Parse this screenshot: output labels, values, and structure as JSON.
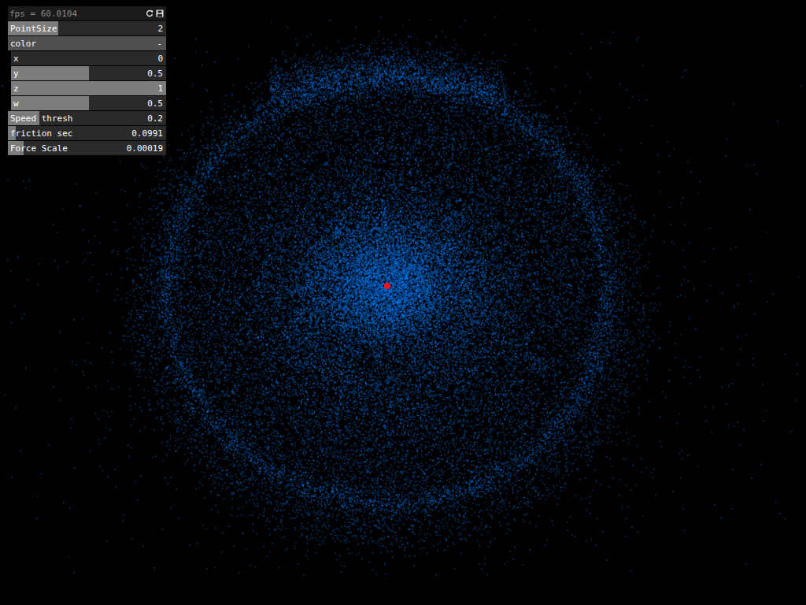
{
  "panel": {
    "header": "fps = 60.0104",
    "controls": [
      {
        "kind": "slider",
        "label": "PointSize",
        "value": "2",
        "level": 0.32
      },
      {
        "kind": "group",
        "label": "color",
        "toggle": "-",
        "expanded": true,
        "items": [
          {
            "label": "x",
            "value": "0",
            "level": 0
          },
          {
            "label": "y",
            "value": "0.5",
            "level": 0.5
          },
          {
            "label": "z",
            "value": "1",
            "level": 1
          },
          {
            "label": "w",
            "value": "0.5",
            "level": 0.5
          }
        ]
      },
      {
        "kind": "slider",
        "label": "Speed thresh",
        "value": "0.2",
        "level": 0.2
      },
      {
        "kind": "slider",
        "label": "friction sec",
        "value": "0.0991",
        "level": 0.05
      },
      {
        "kind": "slider",
        "label": "Force Scale",
        "value": "0.00019",
        "level": 0.1
      }
    ]
  }
}
